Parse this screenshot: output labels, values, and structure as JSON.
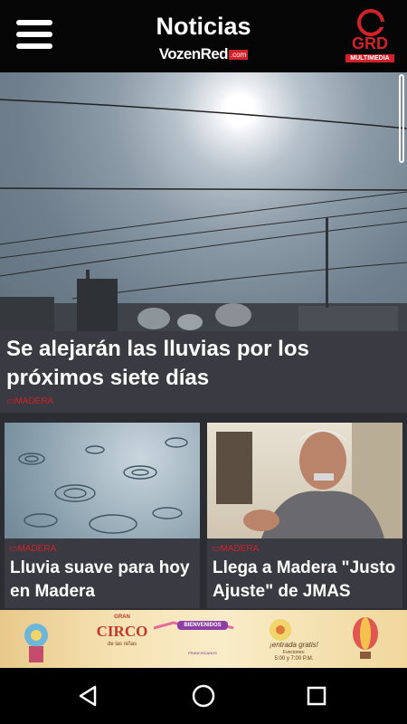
{
  "header": {
    "title": "Noticias",
    "brand": "VozenRed",
    "brand_suffix": ".com",
    "partner_logo_text": "GRD",
    "partner_logo_sub": "MULTIMEDIA"
  },
  "featured": {
    "title": "Se alejarán las lluvias por los próximos siete días",
    "category": "MADERA"
  },
  "articles": [
    {
      "title": "Lluvia suave para hoy en Madera",
      "category": "MADERA"
    },
    {
      "title": "Llega a Madera \"Justo Ajuste\" de JMAS",
      "category": "MADERA"
    }
  ],
  "ad_banner": {
    "headline_top": "GRAN",
    "headline_main": "CIRCO",
    "headline_sub": "de las niñas",
    "ribbon": "BIENVENIDOS",
    "sponsor": "FRANCISCANOS",
    "entry": "¡entrada gratis!",
    "schedule_label": "Funciones:",
    "schedule": "5:00 y 7:00 P.M."
  },
  "colors": {
    "accent": "#d1222a",
    "header_bg": "#050505",
    "card_bg": "#3a3a42",
    "page_bg": "#2c2c33"
  },
  "icons": {
    "menu": "hamburger-icon",
    "back": "back-triangle-icon",
    "home": "home-circle-icon",
    "recents": "recents-square-icon"
  }
}
